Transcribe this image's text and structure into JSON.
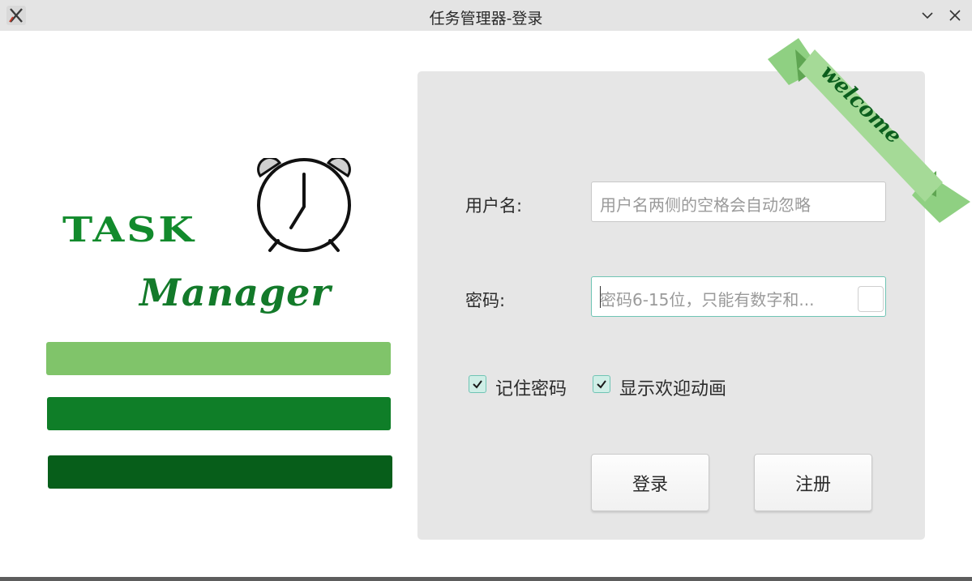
{
  "window": {
    "title": "任务管理器-登录",
    "app_icon": "app-x-icon",
    "controls": [
      "chevron-down-icon",
      "close-icon"
    ]
  },
  "logo": {
    "word_1": "TASK",
    "word_2": "Manager",
    "icon": "alarm-clock-icon",
    "colors": {
      "task_text": "#128a2c",
      "bar_light": "#80c46a",
      "bar_mid": "#0f7e28",
      "bar_dark": "#075e1a"
    }
  },
  "panel": {
    "ribbon_text": "welcome",
    "username": {
      "label": "用户名:",
      "placeholder": "用户名两侧的空格会自动忽略",
      "value": ""
    },
    "password": {
      "label": "密码:",
      "placeholder": "密码6-15位，只能有数字和...",
      "value": ""
    },
    "options": [
      {
        "label": "记住密码",
        "checked": true
      },
      {
        "label": "显示欢迎动画",
        "checked": true
      }
    ],
    "buttons": {
      "login": "登录",
      "register": "注册"
    }
  }
}
